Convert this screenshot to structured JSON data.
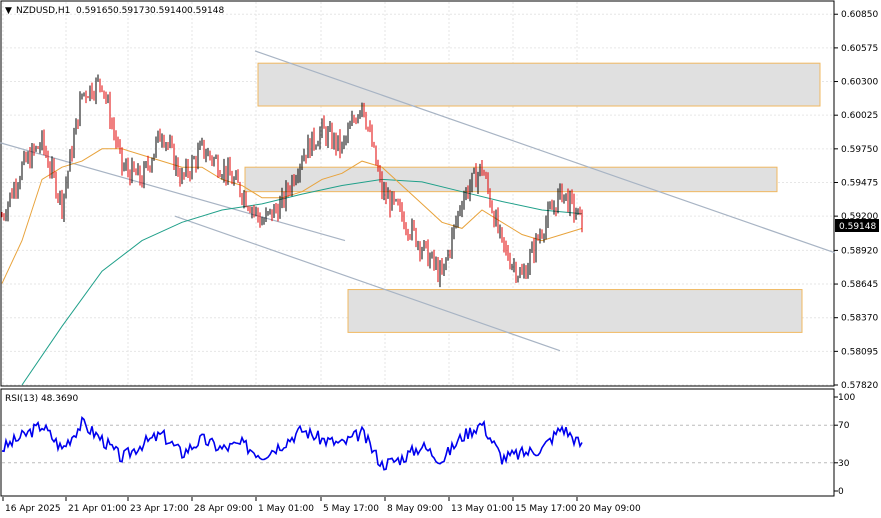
{
  "header": {
    "symbol": "NZDUSD,H1",
    "open": "0.59165",
    "high": "0.59173",
    "low": "0.59140",
    "close": "0.59148"
  },
  "rsi": {
    "label": "RSI(13) 48.3690",
    "ticks": [
      "100",
      "70",
      "30",
      "0"
    ]
  },
  "price_axis": {
    "ticks": [
      "0.60850",
      "0.60575",
      "0.60300",
      "0.60025",
      "0.59750",
      "0.59475",
      "0.59200",
      "0.58920",
      "0.58645",
      "0.58370",
      "0.58095",
      "0.57820"
    ],
    "current": "0.59148"
  },
  "time_axis": [
    "16 Apr 2025",
    "21 Apr 01:00",
    "23 Apr 17:00",
    "28 Apr 09:00",
    "1 May 01:00",
    "5 May 17:00",
    "8 May 09:00",
    "13 May 01:00",
    "15 May 17:00",
    "20 May 09:00"
  ],
  "colors": {
    "bull": "#000000",
    "bear": "#e00000",
    "ma_fast": "#e8a33c",
    "ma_slow": "#20a08a",
    "rsi_line": "#0000ee",
    "zone_fill": "#e0e0e0",
    "zone_border": "#f0b860",
    "channel": "#a8b4c4"
  },
  "chart_data": {
    "type": "line",
    "title": "NZDUSD,H1",
    "x": [
      "16 Apr 2025",
      "21 Apr 01:00",
      "23 Apr 17:00",
      "28 Apr 09:00",
      "1 May 01:00",
      "5 May 17:00",
      "8 May 09:00",
      "13 May 01:00",
      "15 May 17:00",
      "20 May 09:00"
    ],
    "ylim": [
      0.5782,
      0.6095
    ],
    "series": [
      {
        "name": "",
        "values": [
          0.5905,
          0.5975,
          0.6005,
          0.5965,
          0.5945,
          0.602,
          0.592,
          0.5875,
          0.5945,
          0.5915
        ]
      }
    ],
    "price_path_points": [
      [
        0,
        0.592
      ],
      [
        20,
        0.596
      ],
      [
        40,
        0.598
      ],
      [
        60,
        0.593
      ],
      [
        80,
        0.602
      ],
      [
        100,
        0.603
      ],
      [
        120,
        0.596
      ],
      [
        140,
        0.595
      ],
      [
        160,
        0.599
      ],
      [
        180,
        0.595
      ],
      [
        200,
        0.5975
      ],
      [
        220,
        0.596
      ],
      [
        240,
        0.594
      ],
      [
        260,
        0.5915
      ],
      [
        280,
        0.593
      ],
      [
        300,
        0.597
      ],
      [
        320,
        0.599
      ],
      [
        340,
        0.5975
      ],
      [
        360,
        0.6015
      ],
      [
        380,
        0.594
      ],
      [
        400,
        0.592
      ],
      [
        420,
        0.5895
      ],
      [
        440,
        0.587
      ],
      [
        460,
        0.5935
      ],
      [
        480,
        0.596
      ],
      [
        500,
        0.5895
      ],
      [
        520,
        0.587
      ],
      [
        540,
        0.591
      ],
      [
        560,
        0.594
      ],
      [
        580,
        0.5915
      ]
    ],
    "rsi_points": [
      [
        0,
        45
      ],
      [
        20,
        58
      ],
      [
        40,
        70
      ],
      [
        60,
        45
      ],
      [
        80,
        72
      ],
      [
        100,
        55
      ],
      [
        120,
        35
      ],
      [
        140,
        50
      ],
      [
        160,
        60
      ],
      [
        180,
        40
      ],
      [
        200,
        55
      ],
      [
        220,
        45
      ],
      [
        240,
        50
      ],
      [
        260,
        38
      ],
      [
        280,
        50
      ],
      [
        300,
        65
      ],
      [
        320,
        55
      ],
      [
        340,
        50
      ],
      [
        360,
        62
      ],
      [
        380,
        28
      ],
      [
        400,
        35
      ],
      [
        420,
        48
      ],
      [
        440,
        33
      ],
      [
        460,
        58
      ],
      [
        480,
        72
      ],
      [
        500,
        35
      ],
      [
        520,
        40
      ],
      [
        540,
        45
      ],
      [
        560,
        68
      ],
      [
        580,
        48
      ]
    ],
    "ma_fast_points": [
      [
        0,
        0.5865
      ],
      [
        20,
        0.59
      ],
      [
        40,
        0.595
      ],
      [
        60,
        0.596
      ],
      [
        80,
        0.5965
      ],
      [
        100,
        0.5975
      ],
      [
        120,
        0.5975
      ],
      [
        140,
        0.597
      ],
      [
        160,
        0.5965
      ],
      [
        180,
        0.596
      ],
      [
        200,
        0.596
      ],
      [
        220,
        0.595
      ],
      [
        240,
        0.5945
      ],
      [
        260,
        0.5935
      ],
      [
        280,
        0.5935
      ],
      [
        300,
        0.594
      ],
      [
        320,
        0.595
      ],
      [
        340,
        0.5955
      ],
      [
        360,
        0.5965
      ],
      [
        380,
        0.596
      ],
      [
        400,
        0.5945
      ],
      [
        420,
        0.593
      ],
      [
        440,
        0.5915
      ],
      [
        460,
        0.591
      ],
      [
        480,
        0.5925
      ],
      [
        500,
        0.5915
      ],
      [
        520,
        0.5905
      ],
      [
        540,
        0.59
      ],
      [
        560,
        0.5905
      ],
      [
        580,
        0.591
      ]
    ],
    "ma_slow_points": [
      [
        20,
        0.5782
      ],
      [
        60,
        0.583
      ],
      [
        100,
        0.5875
      ],
      [
        140,
        0.59
      ],
      [
        180,
        0.5915
      ],
      [
        220,
        0.5925
      ],
      [
        260,
        0.593
      ],
      [
        300,
        0.5938
      ],
      [
        340,
        0.5945
      ],
      [
        380,
        0.595
      ],
      [
        420,
        0.5948
      ],
      [
        460,
        0.594
      ],
      [
        500,
        0.5932
      ],
      [
        540,
        0.5925
      ],
      [
        580,
        0.5922
      ]
    ],
    "zones": [
      {
        "x0": 258,
        "x1": 820,
        "top": 0.6045,
        "bottom": 0.601
      },
      {
        "x0": 245,
        "x1": 777,
        "top": 0.596,
        "bottom": 0.594
      },
      {
        "x0": 348,
        "x1": 802,
        "top": 0.586,
        "bottom": 0.5825
      }
    ],
    "channel_lines": [
      [
        [
          0,
          0.598
        ],
        [
          345,
          0.59
        ]
      ],
      [
        [
          255,
          0.6055
        ],
        [
          835,
          0.589
        ]
      ],
      [
        [
          175,
          0.592
        ],
        [
          560,
          0.581
        ]
      ]
    ]
  }
}
